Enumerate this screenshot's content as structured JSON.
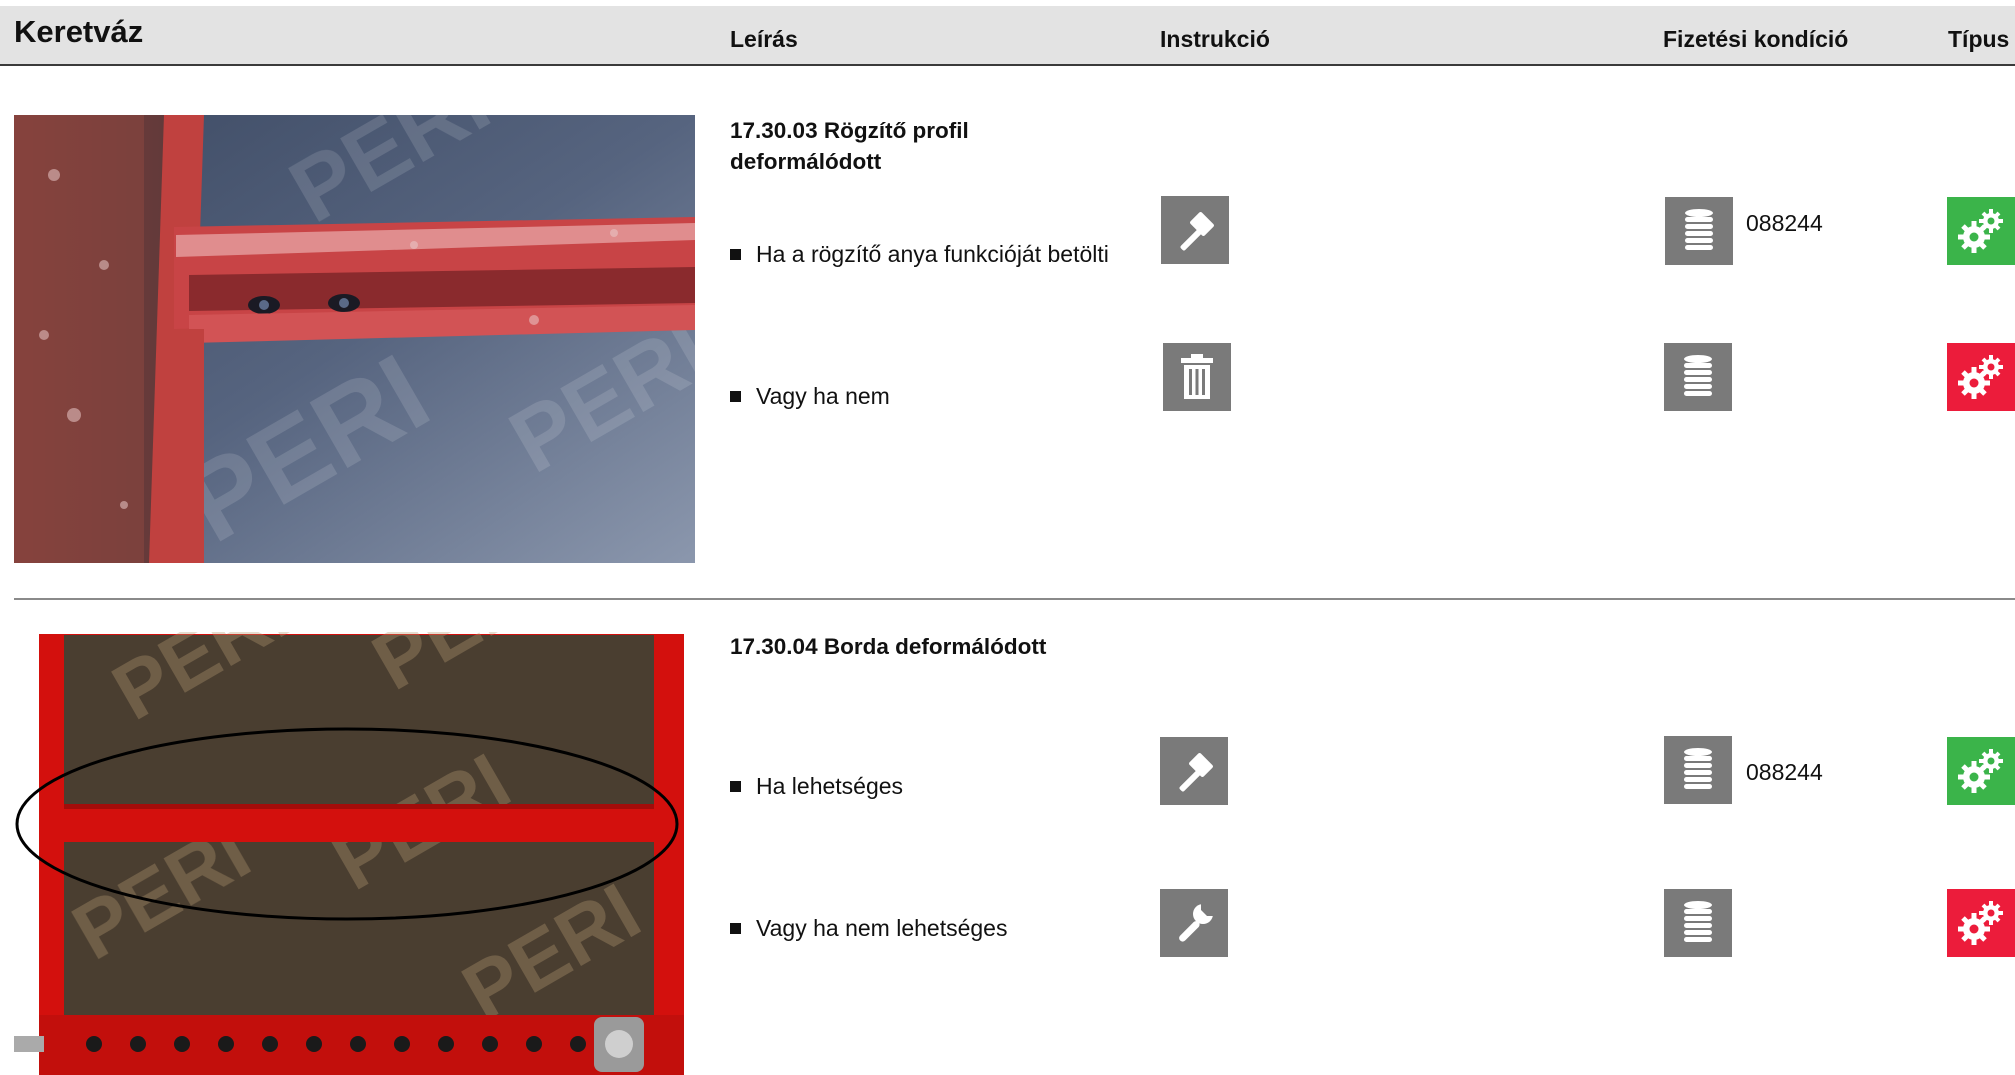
{
  "header": {
    "title": "Keretváz",
    "col_description": "Leírás",
    "col_instruction": "Instrukció",
    "col_payment": "Fizetési kondíció",
    "col_type": "Típus"
  },
  "items": [
    {
      "title": "17.30.03 Rögzítő profil deformálódott",
      "options": [
        {
          "text": "Ha a rögzítő anya funkcióját betölti",
          "instruction_icon": "hammer-icon",
          "payment_icon": "coin-stack-icon",
          "code": "088244",
          "type_icon": "gears-icon",
          "type_color": "#3bb44a"
        },
        {
          "text": "Vagy ha nem",
          "instruction_icon": "trash-icon",
          "payment_icon": "coin-stack-icon",
          "code": "",
          "type_icon": "gears-icon",
          "type_color": "#ec1c3b"
        }
      ],
      "photo_watermark": "PERI"
    },
    {
      "title": "17.30.04 Borda deformálódott",
      "options": [
        {
          "text": "Ha lehetséges",
          "instruction_icon": "hammer-icon",
          "payment_icon": "coin-stack-icon",
          "code": "088244",
          "type_icon": "gears-icon",
          "type_color": "#3bb44a"
        },
        {
          "text": "Vagy ha nem lehetséges",
          "instruction_icon": "wrench-icon",
          "payment_icon": "coin-stack-icon",
          "code": "",
          "type_icon": "gears-icon",
          "type_color": "#ec1c3b"
        }
      ],
      "photo_watermark": "PERI"
    }
  ]
}
